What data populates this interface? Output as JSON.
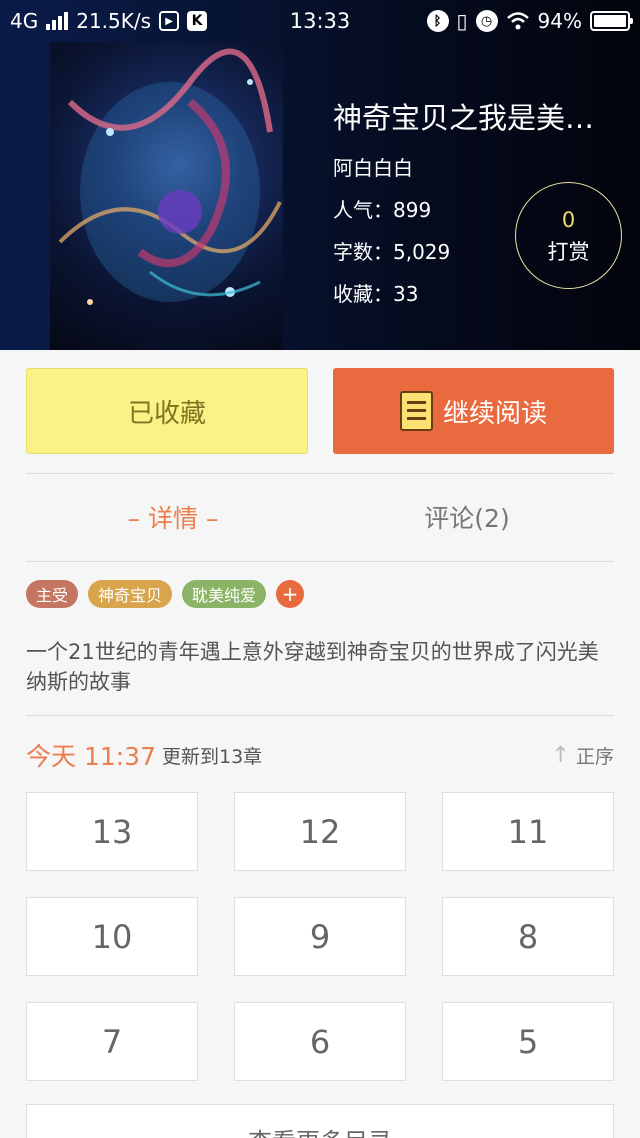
{
  "status_bar": {
    "network": "4G",
    "speed": "21.5K/s",
    "time": "13:33",
    "battery": "94%"
  },
  "book": {
    "title": "神奇宝贝之我是美…",
    "author": "阿白白白",
    "popularity": "人气：899",
    "word_count": "字数：5,029",
    "favorites": "收藏：33"
  },
  "tip": {
    "count": "0",
    "label": "打赏"
  },
  "actions": {
    "favorited": "已收藏",
    "continue_reading": "继续阅读"
  },
  "tabs": {
    "details": "– 详情 –",
    "comments": "评论(2)"
  },
  "tags": [
    {
      "label": "主受",
      "color": "#c47662"
    },
    {
      "label": "神奇宝贝",
      "color": "#d8a44c"
    },
    {
      "label": "耽美纯爱",
      "color": "#8cb466"
    }
  ],
  "tag_add": "+",
  "description": "一个21世纪的青年遇上意外穿越到神奇宝贝的世界成了闪光美纳斯的故事",
  "update": {
    "time": "今天 11:37",
    "text": "更新到13章",
    "order": "正序"
  },
  "chapters": [
    "13",
    "12",
    "11",
    "10",
    "9",
    "8",
    "7",
    "6",
    "5"
  ],
  "more_chapters": "查看更多目录",
  "colors": {
    "accent": "#ea6a40",
    "favorite_bg": "#fbf287"
  }
}
